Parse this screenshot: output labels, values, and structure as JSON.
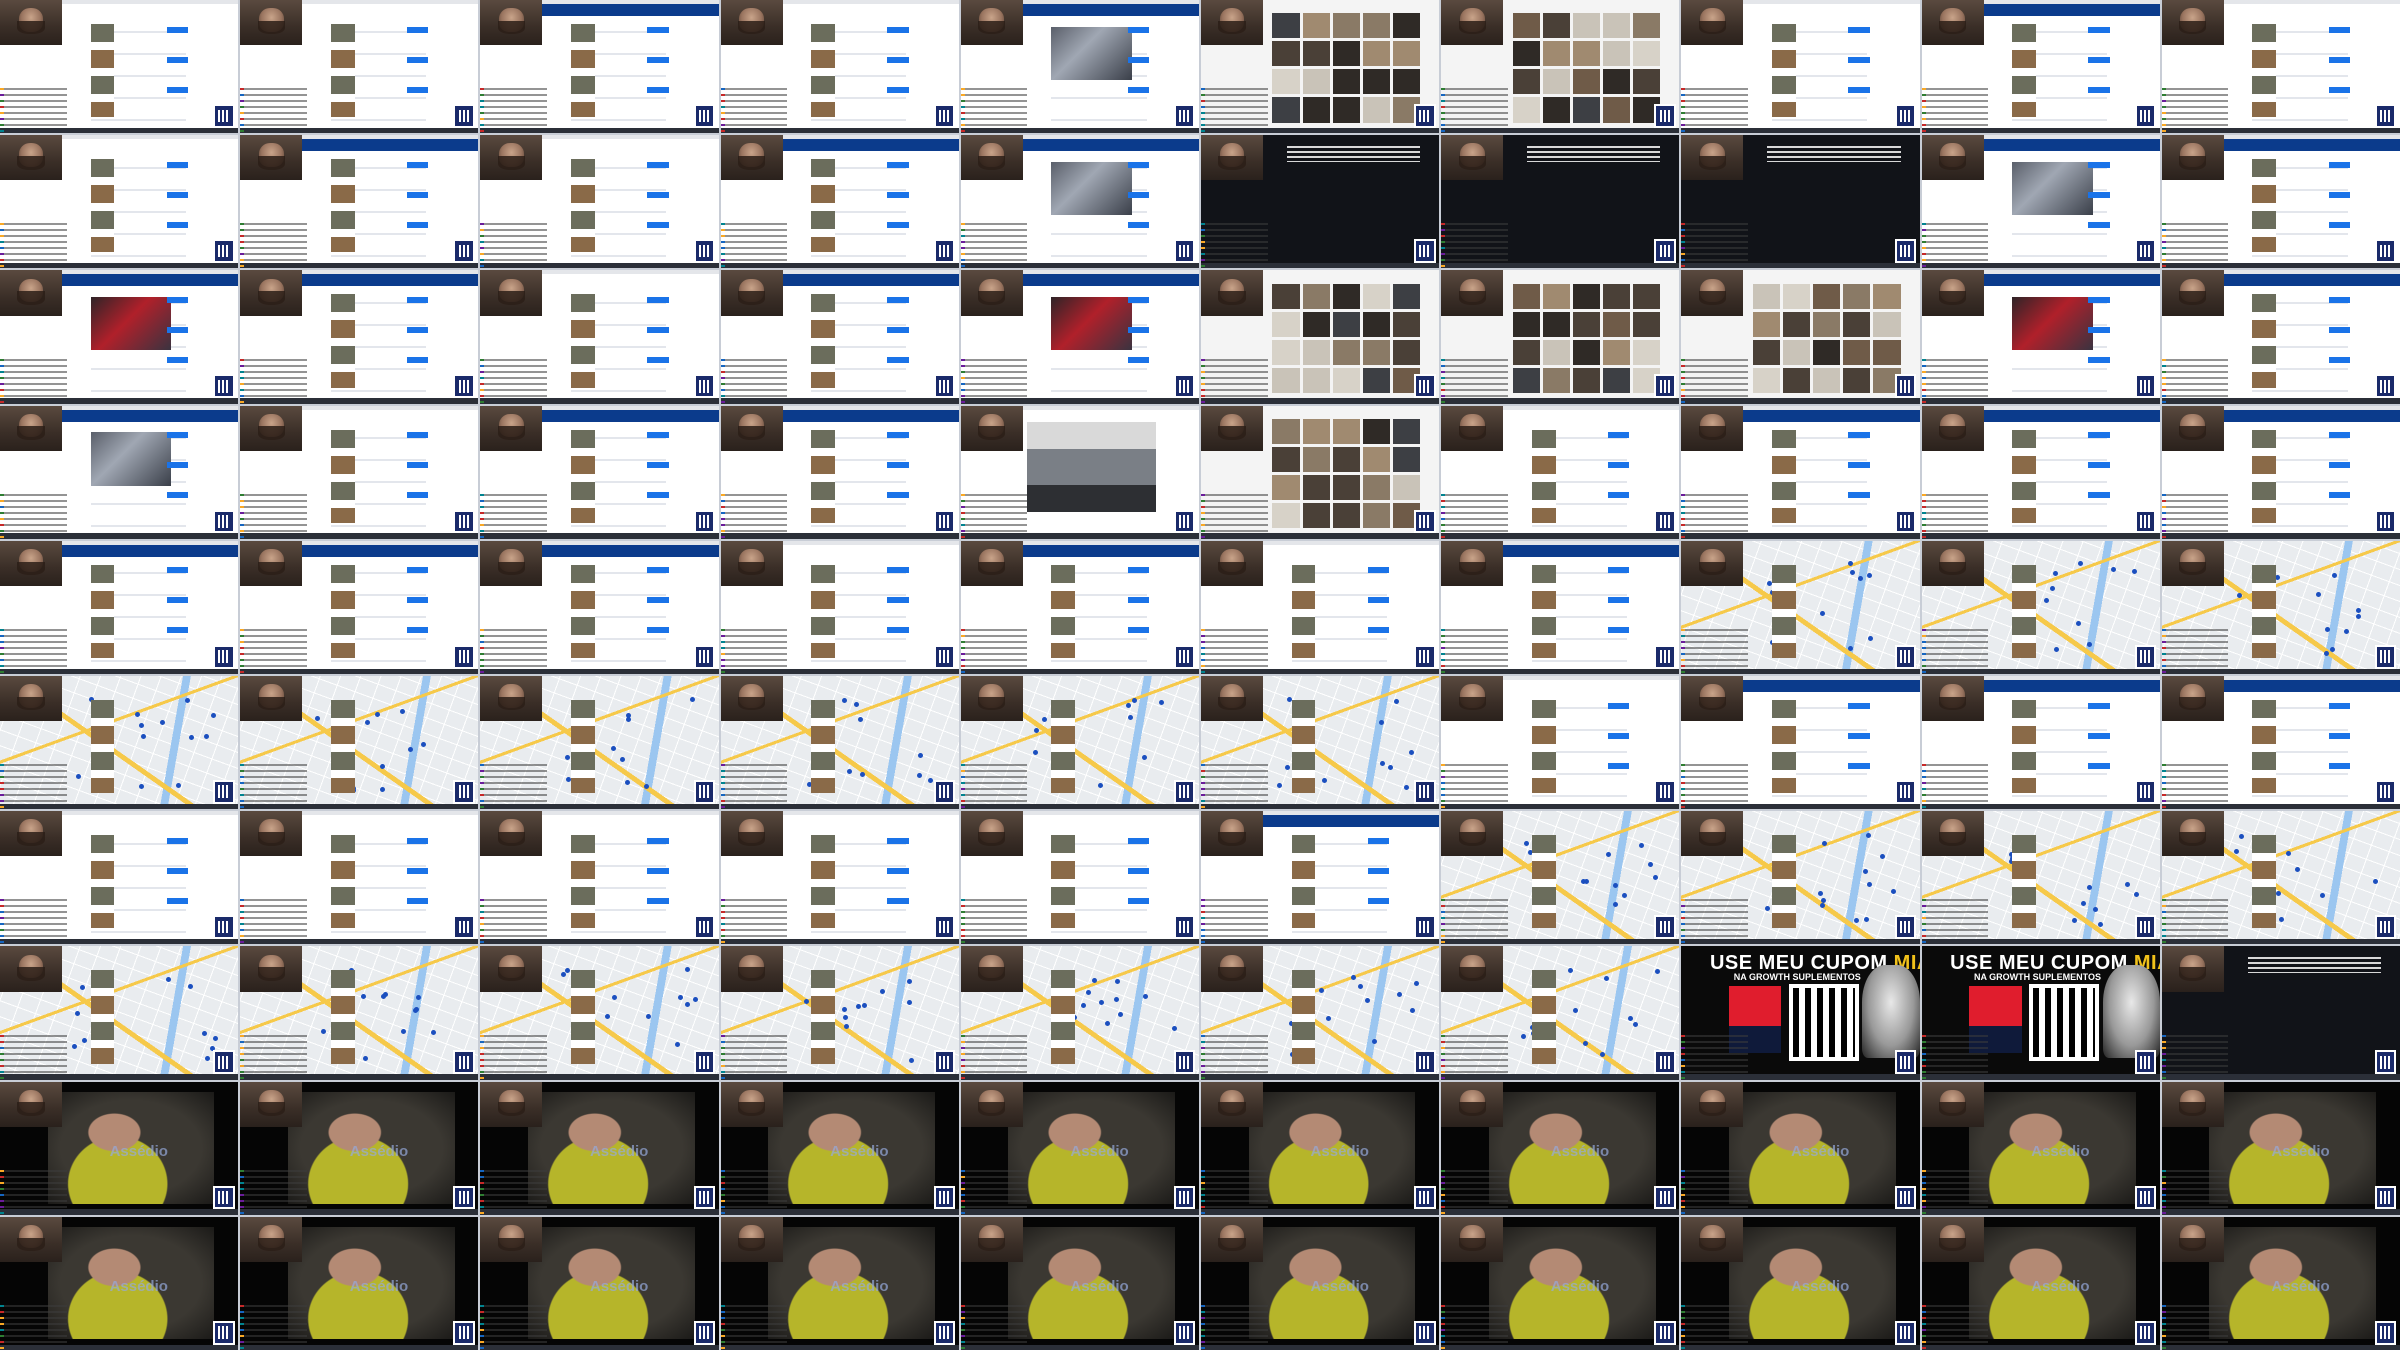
{
  "grid": {
    "columns": 10,
    "rows": 10
  },
  "tile_types": [
    "list",
    "list",
    "booking",
    "list",
    "hotel",
    "gallery",
    "gallery",
    "list",
    "booking",
    "list",
    "list",
    "booking",
    "list",
    "booking",
    "hotel",
    "dark",
    "dark",
    "dark",
    "hotel",
    "booking",
    "hotel-red",
    "booking",
    "list",
    "booking",
    "hotel-red",
    "gallery",
    "gallery",
    "gallery",
    "hotel-red",
    "booking",
    "hotel",
    "list",
    "booking",
    "booking",
    "gym",
    "gallery",
    "list",
    "booking",
    "booking",
    "booking",
    "booking",
    "booking",
    "booking",
    "list",
    "booking",
    "list",
    "booking",
    "map",
    "map",
    "map",
    "map",
    "map",
    "map",
    "map",
    "map",
    "map",
    "list",
    "booking",
    "booking",
    "booking",
    "list",
    "list",
    "list",
    "list",
    "list",
    "booking",
    "map",
    "map",
    "map",
    "map",
    "map",
    "map",
    "map",
    "map",
    "map",
    "map",
    "map",
    "promo",
    "promo",
    "dark-live",
    "face",
    "face",
    "face",
    "face",
    "face",
    "face",
    "face",
    "face",
    "face",
    "face",
    "face",
    "face",
    "face",
    "face",
    "face",
    "face",
    "face",
    "face",
    "face",
    "face"
  ],
  "promo": {
    "title_prefix": "USE MEU CUPOM ",
    "title_code": "MIAU",
    "subtitle": "NA GROWTH SUPLEMENTOS"
  },
  "watermark": "Assédio",
  "colors": {
    "booking_blue": "#0b3b8c",
    "accent_button": "#1a73e8",
    "promo_yellow": "#f2c21a",
    "map_road": "#f6c94a",
    "map_water": "#9bc6f0",
    "pin": "#1b4fbf"
  },
  "icons": {
    "webcam": "webcam-overlay-icon",
    "qr": "qr-code-icon",
    "chat": "chat-overlay-icon"
  }
}
